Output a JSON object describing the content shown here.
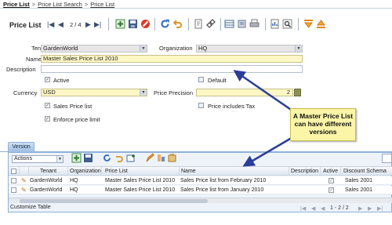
{
  "breadcrumb": {
    "root": "Price List",
    "items": [
      "Price List Search",
      "Price List"
    ]
  },
  "toolbar": {
    "title": "Price List",
    "record_count": "2 / 4"
  },
  "form": {
    "tenant": {
      "label": "Tenant",
      "value": "GardenWorld"
    },
    "organization": {
      "label": "Organization",
      "value": "HQ"
    },
    "name": {
      "label": "Name",
      "value": "Master Sales Price List 2010"
    },
    "description": {
      "label": "Description",
      "value": ""
    },
    "active": {
      "label": "Active",
      "checked": true
    },
    "default": {
      "label": "Default",
      "checked": false
    },
    "currency": {
      "label": "Currency",
      "value": "USD"
    },
    "price_precision": {
      "label": "Price Precision",
      "value": "2"
    },
    "sales_price_list": {
      "label": "Sales Price list",
      "checked": true
    },
    "price_includes_tax": {
      "label": "Price includes Tax",
      "checked": false
    },
    "enforce_price_limit": {
      "label": "Enforce price limit",
      "checked": true
    }
  },
  "callout": {
    "line1": "A Master Price List",
    "line2": "can have different",
    "line3": "versions"
  },
  "tabs": [
    {
      "label": "Version"
    }
  ],
  "grid": {
    "actions_label": "Actions",
    "columns": [
      "Tenant",
      "Organization",
      "Price List",
      "Name",
      "Description",
      "Active",
      "Discount Schema"
    ],
    "rows": [
      {
        "tenant": "GardenWorld",
        "organization": "HQ",
        "price_list": "Master Sales Price List 2010",
        "name": "Sales Price list from February 2010",
        "description": "",
        "active": true,
        "discount_schema": "Sales 2001"
      },
      {
        "tenant": "GardenWorld",
        "organization": "HQ",
        "price_list": "Master Sales Price List 2010",
        "name": "Sales Price list from January 2010",
        "description": "",
        "active": true,
        "discount_schema": "Sales 2001"
      }
    ],
    "customize_label": "Customize Table",
    "pager_text": "1 - 2 / 2"
  },
  "colors": {
    "mandatory": "#fff8c6",
    "accent": "#8eb0d8",
    "callout": "#fbf5a7",
    "arrow": "#2b3d9a"
  }
}
